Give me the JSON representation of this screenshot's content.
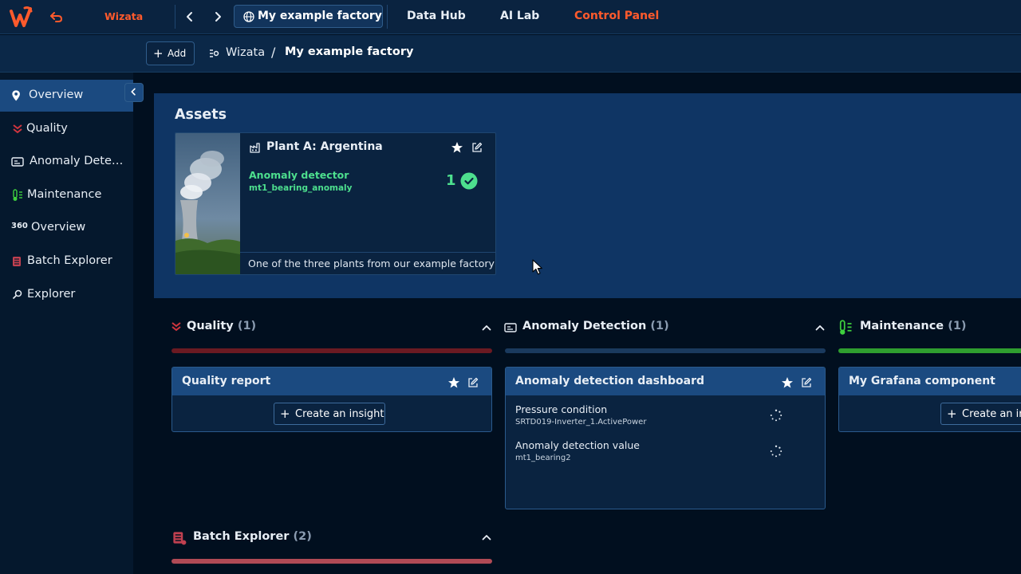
{
  "topbar": {
    "brand_title": "Wizata",
    "factory_tab": "My example factory",
    "nav_links": [
      "Data Hub",
      "AI Lab",
      "Control Panel"
    ]
  },
  "crumbbar": {
    "add_label": "Add",
    "root": "Wizata",
    "separator": "/",
    "current": "My example factory"
  },
  "sidebar": {
    "items": [
      {
        "label": "Overview",
        "icon": "map-pin-icon"
      },
      {
        "label": "Quality",
        "icon": "double-chevron-down-icon"
      },
      {
        "label": "Anomaly Dete…",
        "icon": "dashboard-card-icon"
      },
      {
        "label": "Maintenance",
        "icon": "thermometer-icon"
      },
      {
        "label": "Overview",
        "icon": "360-icon"
      },
      {
        "label": "Batch Explorer",
        "icon": "batch-icon"
      },
      {
        "label": "Explorer",
        "icon": "magnifier-icon"
      }
    ]
  },
  "assets": {
    "title": "Assets",
    "card": {
      "name": "Plant A: Argentina",
      "detector_title": "Anomaly detector",
      "detector_sub": "mt1_bearing_anomaly",
      "count": "1",
      "description": "One of the three plants from our example factory"
    }
  },
  "sections": {
    "quality": {
      "title": "Quality",
      "count": "(1)",
      "card_title": "Quality report",
      "insight_label": "Create an insight"
    },
    "anomaly": {
      "title": "Anomaly Detection",
      "count": "(1)",
      "card_title": "Anomaly detection dashboard",
      "metrics": [
        {
          "name": "Pressure condition",
          "sub": "SRTD019-Inverter_1.ActivePower"
        },
        {
          "name": "Anomaly detection value",
          "sub": "mt1_bearing2"
        }
      ]
    },
    "maintenance": {
      "title": "Maintenance",
      "count": "(1)",
      "card_title": "My Grafana component",
      "insight_label": "Create an in"
    },
    "batch": {
      "title": "Batch Explorer",
      "count": "(2)"
    }
  },
  "colors": {
    "accent": "#ff5a2c",
    "success": "#4ddf8e",
    "quality_bar": "#6b1a22",
    "anomaly_bar": "#1a3a5e",
    "maintenance_bar": "#2f9e2f",
    "batch_bar": "#b04a55"
  }
}
